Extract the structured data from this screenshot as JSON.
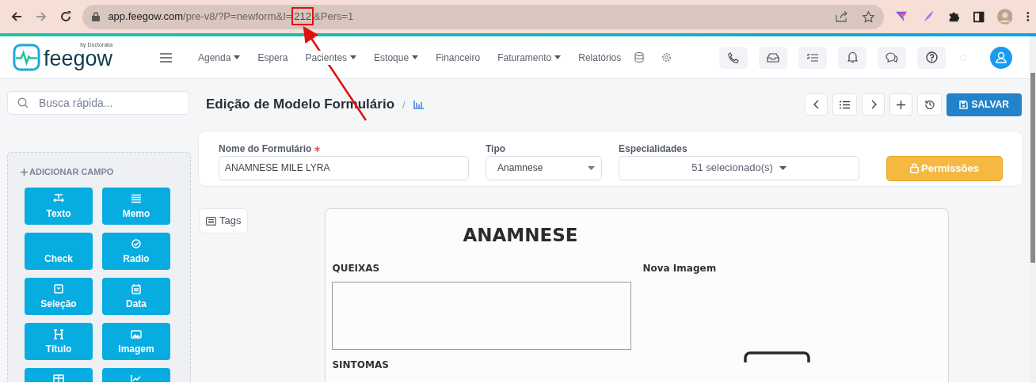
{
  "browser": {
    "url": [
      {
        "kind": "host",
        "text": "app.feegow.com"
      },
      {
        "kind": "path",
        "text": "/pre-v8/?P=newform&I="
      },
      {
        "kind": "highlight",
        "text": "212"
      },
      {
        "kind": "path",
        "text": "&Pers=1"
      }
    ]
  },
  "logo": {
    "name": "feegow",
    "tagline": "by Doctoralia"
  },
  "nav": [
    {
      "label": "Agenda",
      "dropdown": true
    },
    {
      "label": "Espera",
      "dropdown": false
    },
    {
      "label": "Pacientes",
      "dropdown": true
    },
    {
      "label": "Estoque",
      "dropdown": true
    },
    {
      "label": "Financeiro",
      "dropdown": false
    },
    {
      "label": "Faturamento",
      "dropdown": true
    },
    {
      "label": "Relatórios",
      "dropdown": false
    }
  ],
  "sidebar": {
    "search": {
      "placeholder": "Busca rápida..."
    },
    "header": "ADICIONAR CAMPO",
    "fields": [
      "Texto",
      "Memo",
      "Check",
      "Radio",
      "Seleção",
      "Data",
      "Título",
      "Imagem"
    ]
  },
  "page": {
    "title": "Edição de Modelo Formulário",
    "separator": "/",
    "save": "SALVAR"
  },
  "form": {
    "name": {
      "label": "Nome do Formulário",
      "required": true,
      "value": "ANAMNESE MILE LYRA"
    },
    "type": {
      "label": "Tipo",
      "value": "Anamnese"
    },
    "specialties": {
      "label": "Especialidades",
      "value": "51 selecionado(s)"
    },
    "permissions": "Permissões"
  },
  "tags": "Tags",
  "preview": {
    "title": "ANAMNESE",
    "fields": [
      {
        "label": "QUEIXAS",
        "kind": "memo"
      },
      {
        "label": "Nova Imagem",
        "kind": "image"
      },
      {
        "label": "SINTOMAS",
        "kind": "label"
      }
    ]
  }
}
